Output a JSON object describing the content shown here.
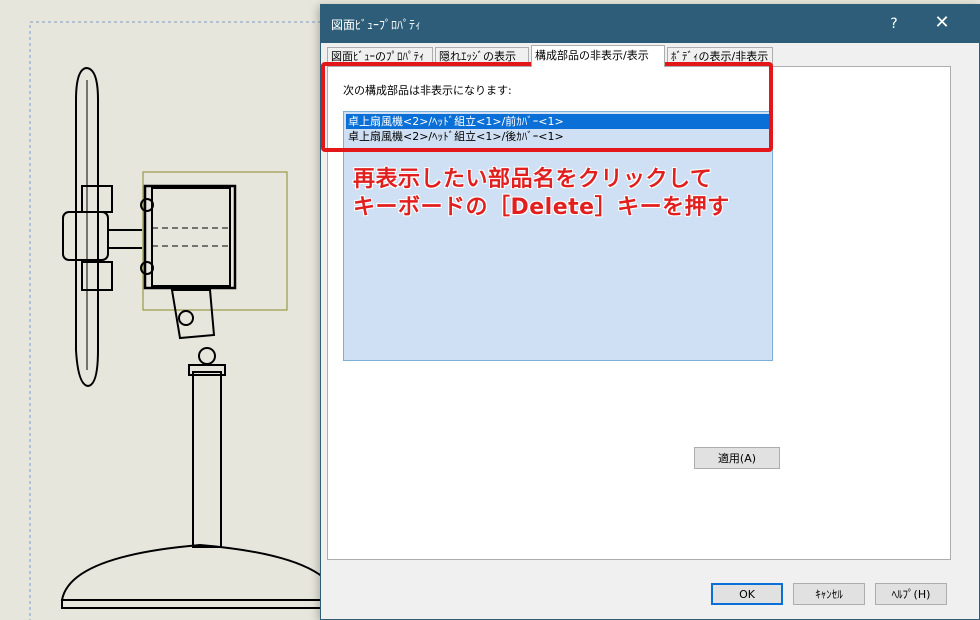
{
  "dialog": {
    "title": "図面ﾋﾞｭｰﾌﾟﾛﾊﾟﾃｨ",
    "help_glyph": "?",
    "close_glyph": "✕"
  },
  "tabs": [
    {
      "label": "図面ﾋﾞｭｰのﾌﾟﾛﾊﾟﾃｨ"
    },
    {
      "label": "隠れｴｯｼﾞの表示"
    },
    {
      "label": "構成部品の非表示/表示"
    },
    {
      "label": "ﾎﾞﾃﾞｨの表示/非表示"
    }
  ],
  "panel": {
    "label": "次の構成部品は非表示になります:",
    "items": [
      {
        "text": "卓上扇風機<2>/ﾍｯﾄﾞ組立<1>/前ｶﾊﾞｰ<1>",
        "selected": true
      },
      {
        "text": "卓上扇風機<2>/ﾍｯﾄﾞ組立<1>/後ｶﾊﾞｰ<1>",
        "selected": false
      }
    ]
  },
  "annotation": {
    "line1": "再表示したい部品名をクリックして",
    "line2": "キーボードの［Delete］キーを押す",
    "color": "#e11f1f"
  },
  "buttons": {
    "apply": "適用(A)",
    "ok": "OK",
    "cancel": "ｷｬﾝｾﾙ",
    "help": "ﾍﾙﾌﾟ(H)"
  }
}
